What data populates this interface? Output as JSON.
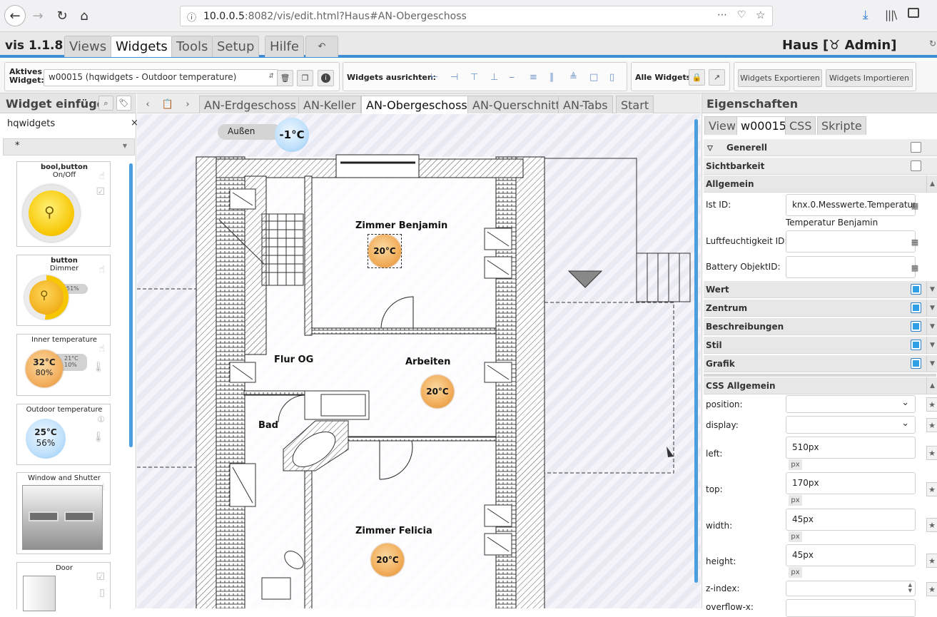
{
  "browser": {
    "url_host": "10.0.0.5",
    "url_rest": ":8082/vis/edit.html?Haus#AN-Obergeschoss",
    "icons": [
      "back-icon",
      "forward-icon",
      "reload-icon",
      "home-icon",
      "info-icon",
      "more-icon",
      "pocket-icon",
      "star-icon",
      "download-icon",
      "library-icon",
      "sidebar-icon"
    ]
  },
  "app": {
    "version": "vis 1.1.8",
    "menu": [
      "Views",
      "Widgets",
      "Tools",
      "Setup",
      "Hilfe"
    ],
    "active_menu": "Widgets",
    "undo_icon": "undo-icon",
    "title": "Haus [♉ Admin]"
  },
  "toolbar": {
    "active_widget_label_1": "Aktives",
    "active_widget_label_2": "Widget:",
    "active_widget_value": "w00015 (hqwidgets - Outdoor temperature)",
    "align_label": "Widgets ausrichten:",
    "all_widgets_label": "Alle Widgets:",
    "export_label": "Widgets Exportieren",
    "import_label": "Widgets Importieren"
  },
  "left_panel": {
    "title": "Widget einfügen",
    "filter_value": "hqwidgets",
    "filter_clear": "×",
    "category": "*",
    "widgets": [
      {
        "title1": "bool,button",
        "title2": "On/Off"
      },
      {
        "title1": "button",
        "title2": "Dimmer",
        "percent": "51%"
      },
      {
        "title1": "Inner temperature",
        "temp": "32°C",
        "hum": "80%",
        "set_temp": "21°C",
        "set_hum": "10%"
      },
      {
        "title1": "Outdoor temperature",
        "temp": "25°C",
        "hum": "56%"
      },
      {
        "title1": "Window and Shutter"
      },
      {
        "title1": "Door"
      }
    ]
  },
  "view_tabs": {
    "tabs": [
      "AN-Erdgeschoss",
      "AN-Keller",
      "AN-Obergeschoss",
      "AN-Querschnitt",
      "AN-Tabs",
      "Start"
    ],
    "active": "AN-Obergeschoss"
  },
  "floorplan": {
    "outdoor_label": "Außen",
    "outdoor_temp": "-1°C",
    "rooms": [
      "Zimmer Benjamin",
      "Flur OG",
      "Arbeiten",
      "Bad",
      "Zimmer Felicia"
    ],
    "temps": [
      "20°C",
      "20°C",
      "20°C"
    ]
  },
  "properties": {
    "title": "Eigenschaften",
    "tabs": [
      "View",
      "w00015",
      "CSS",
      "Skripte"
    ],
    "active_tab": "w00015",
    "groups": {
      "generell": "Generell",
      "sichtbarkeit": "Sichtbarkeit",
      "allgemein": "Allgemein",
      "wert": "Wert",
      "zentrum": "Zentrum",
      "beschreibungen": "Beschreibungen",
      "stil": "Stil",
      "grafik": "Grafik",
      "css_allgemein": "CSS Allgemein"
    },
    "ist_id_label": "Ist ID:",
    "ist_id_value": "knx.0.Messwerte.Temperatur",
    "ist_id_desc": "Temperatur Benjamin",
    "luft_label": "Luftfeuchtigkeit ID:",
    "battery_label": "Battery ObjektID:",
    "css": {
      "position_label": "position:",
      "display_label": "display:",
      "left_label": "left:",
      "left_value": "510px",
      "top_label": "top:",
      "top_value": "170px",
      "width_label": "width:",
      "width_value": "45px",
      "height_label": "height:",
      "height_value": "45px",
      "zindex_label": "z-index:",
      "overflow_label": "overflow-x:",
      "unit": "px"
    }
  }
}
